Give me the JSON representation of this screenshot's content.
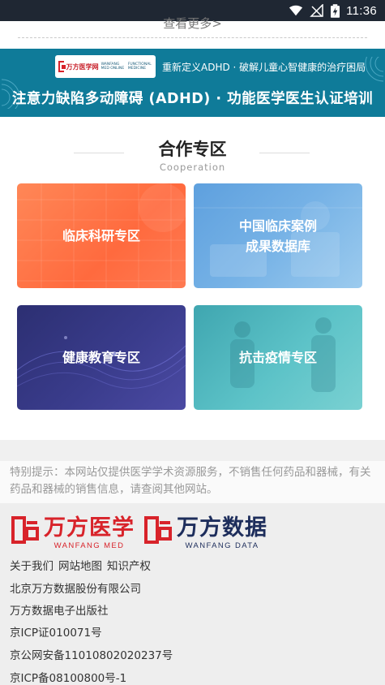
{
  "status_bar": {
    "time": "11:36",
    "icons": [
      "wifi-icon",
      "signal-off-icon",
      "battery-charging-icon"
    ]
  },
  "more": {
    "label": "查看更多>"
  },
  "banner": {
    "logo_text": "万方医学网",
    "logo_subtext": "WANFANG MED ONLINE",
    "partner_text": "FUNCTIONAL MEDICINE",
    "tagline": "重新定义ADHD · 破解儿童心智健康的治疗困局",
    "title": "注意力缺陷多动障碍 (ADHD) · 功能医学医生认证培训",
    "colors": {
      "background": "#0f7b99"
    }
  },
  "cooperation": {
    "title": "合作专区",
    "subtitle": "Cooperation",
    "cards": [
      {
        "label_line1": "临床科研专区",
        "label_line2": "",
        "color": "#ff6f45"
      },
      {
        "label_line1": "中国临床案例",
        "label_line2": "成果数据库",
        "color": "#6aaae3"
      },
      {
        "label_line1": "健康教育专区",
        "label_line2": "",
        "color": "#35387f"
      },
      {
        "label_line1": "抗击疫情专区",
        "label_line2": "",
        "color": "#55bcc2"
      }
    ]
  },
  "notice": {
    "text": "特别提示：本网站仅提供医学学术资源服务，不销售任何药品和器械，有关药品和器械的销售信息，请查阅其他网站。"
  },
  "footer": {
    "logo1": {
      "cn": "万方医学",
      "en": "WANFANG MED",
      "color": "#d8232a"
    },
    "logo2": {
      "cn": "万方数据",
      "en": "WANFANG DATA",
      "color": "#1d2d5b"
    },
    "links": [
      "关于我们",
      "网站地图",
      "知识产权"
    ],
    "lines": [
      "北京万方数据股份有限公司",
      "万方数据电子出版社",
      "京ICP证010071号",
      "京公网安备11010802020237号",
      "京ICP备08100800号-1"
    ]
  }
}
